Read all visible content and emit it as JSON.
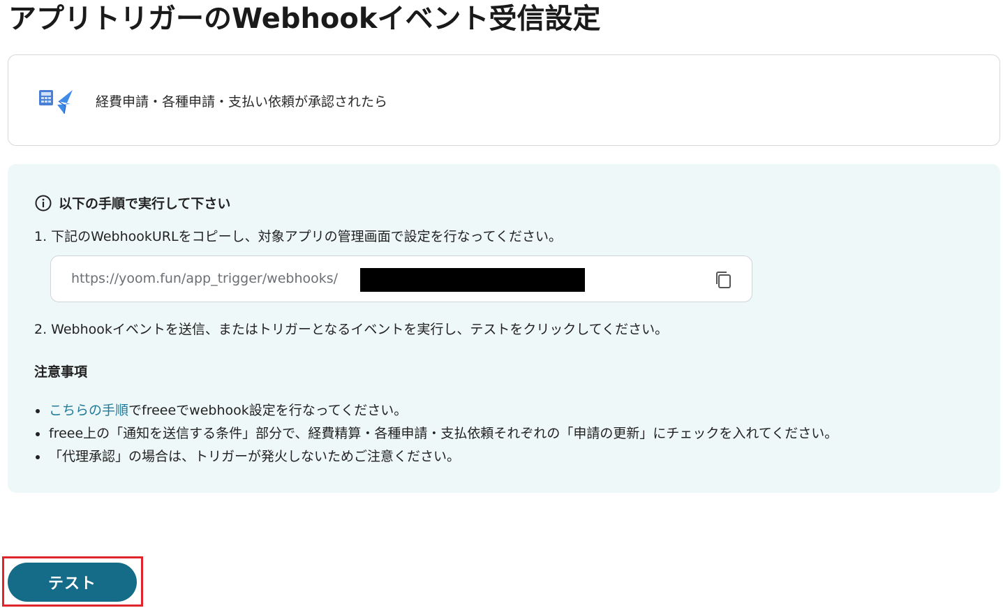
{
  "header": {
    "title": "アプリトリガーのWebhookイベント受信設定"
  },
  "trigger": {
    "app_icon": "freee-app-icon",
    "label": "経費申請・各種申請・支払い依頼が承認されたら"
  },
  "instructions": {
    "icon": "info-icon",
    "heading": "以下の手順で実行して下さい",
    "step1": "1. 下記のWebhookURLをコピーし、対象アプリの管理画面で設定を行なってください。",
    "webhook_url": "https://yoom.fun/app_trigger/webhooks/",
    "copy_icon": "copy-icon",
    "step2": "2. Webhookイベントを送信、またはトリガーとなるイベントを実行し、テストをクリックしてください。"
  },
  "notes": {
    "title": "注意事項",
    "item1_link": "こちらの手順",
    "item1_rest": "でfreeeでwebhook設定を行なってください。",
    "item2": "freee上の「通知を送信する条件」部分で、経費精算・各種申請・支払依頼それぞれの「申請の更新」にチェックを入れてください。",
    "item3": "「代理承認」の場合は、トリガーが発火しないためご注意ください。"
  },
  "actions": {
    "test_label": "テスト"
  },
  "colors": {
    "accent": "#156c88",
    "link": "#1f7a9c",
    "panel_bg": "#eff8f8",
    "highlight": "#e0242b"
  }
}
